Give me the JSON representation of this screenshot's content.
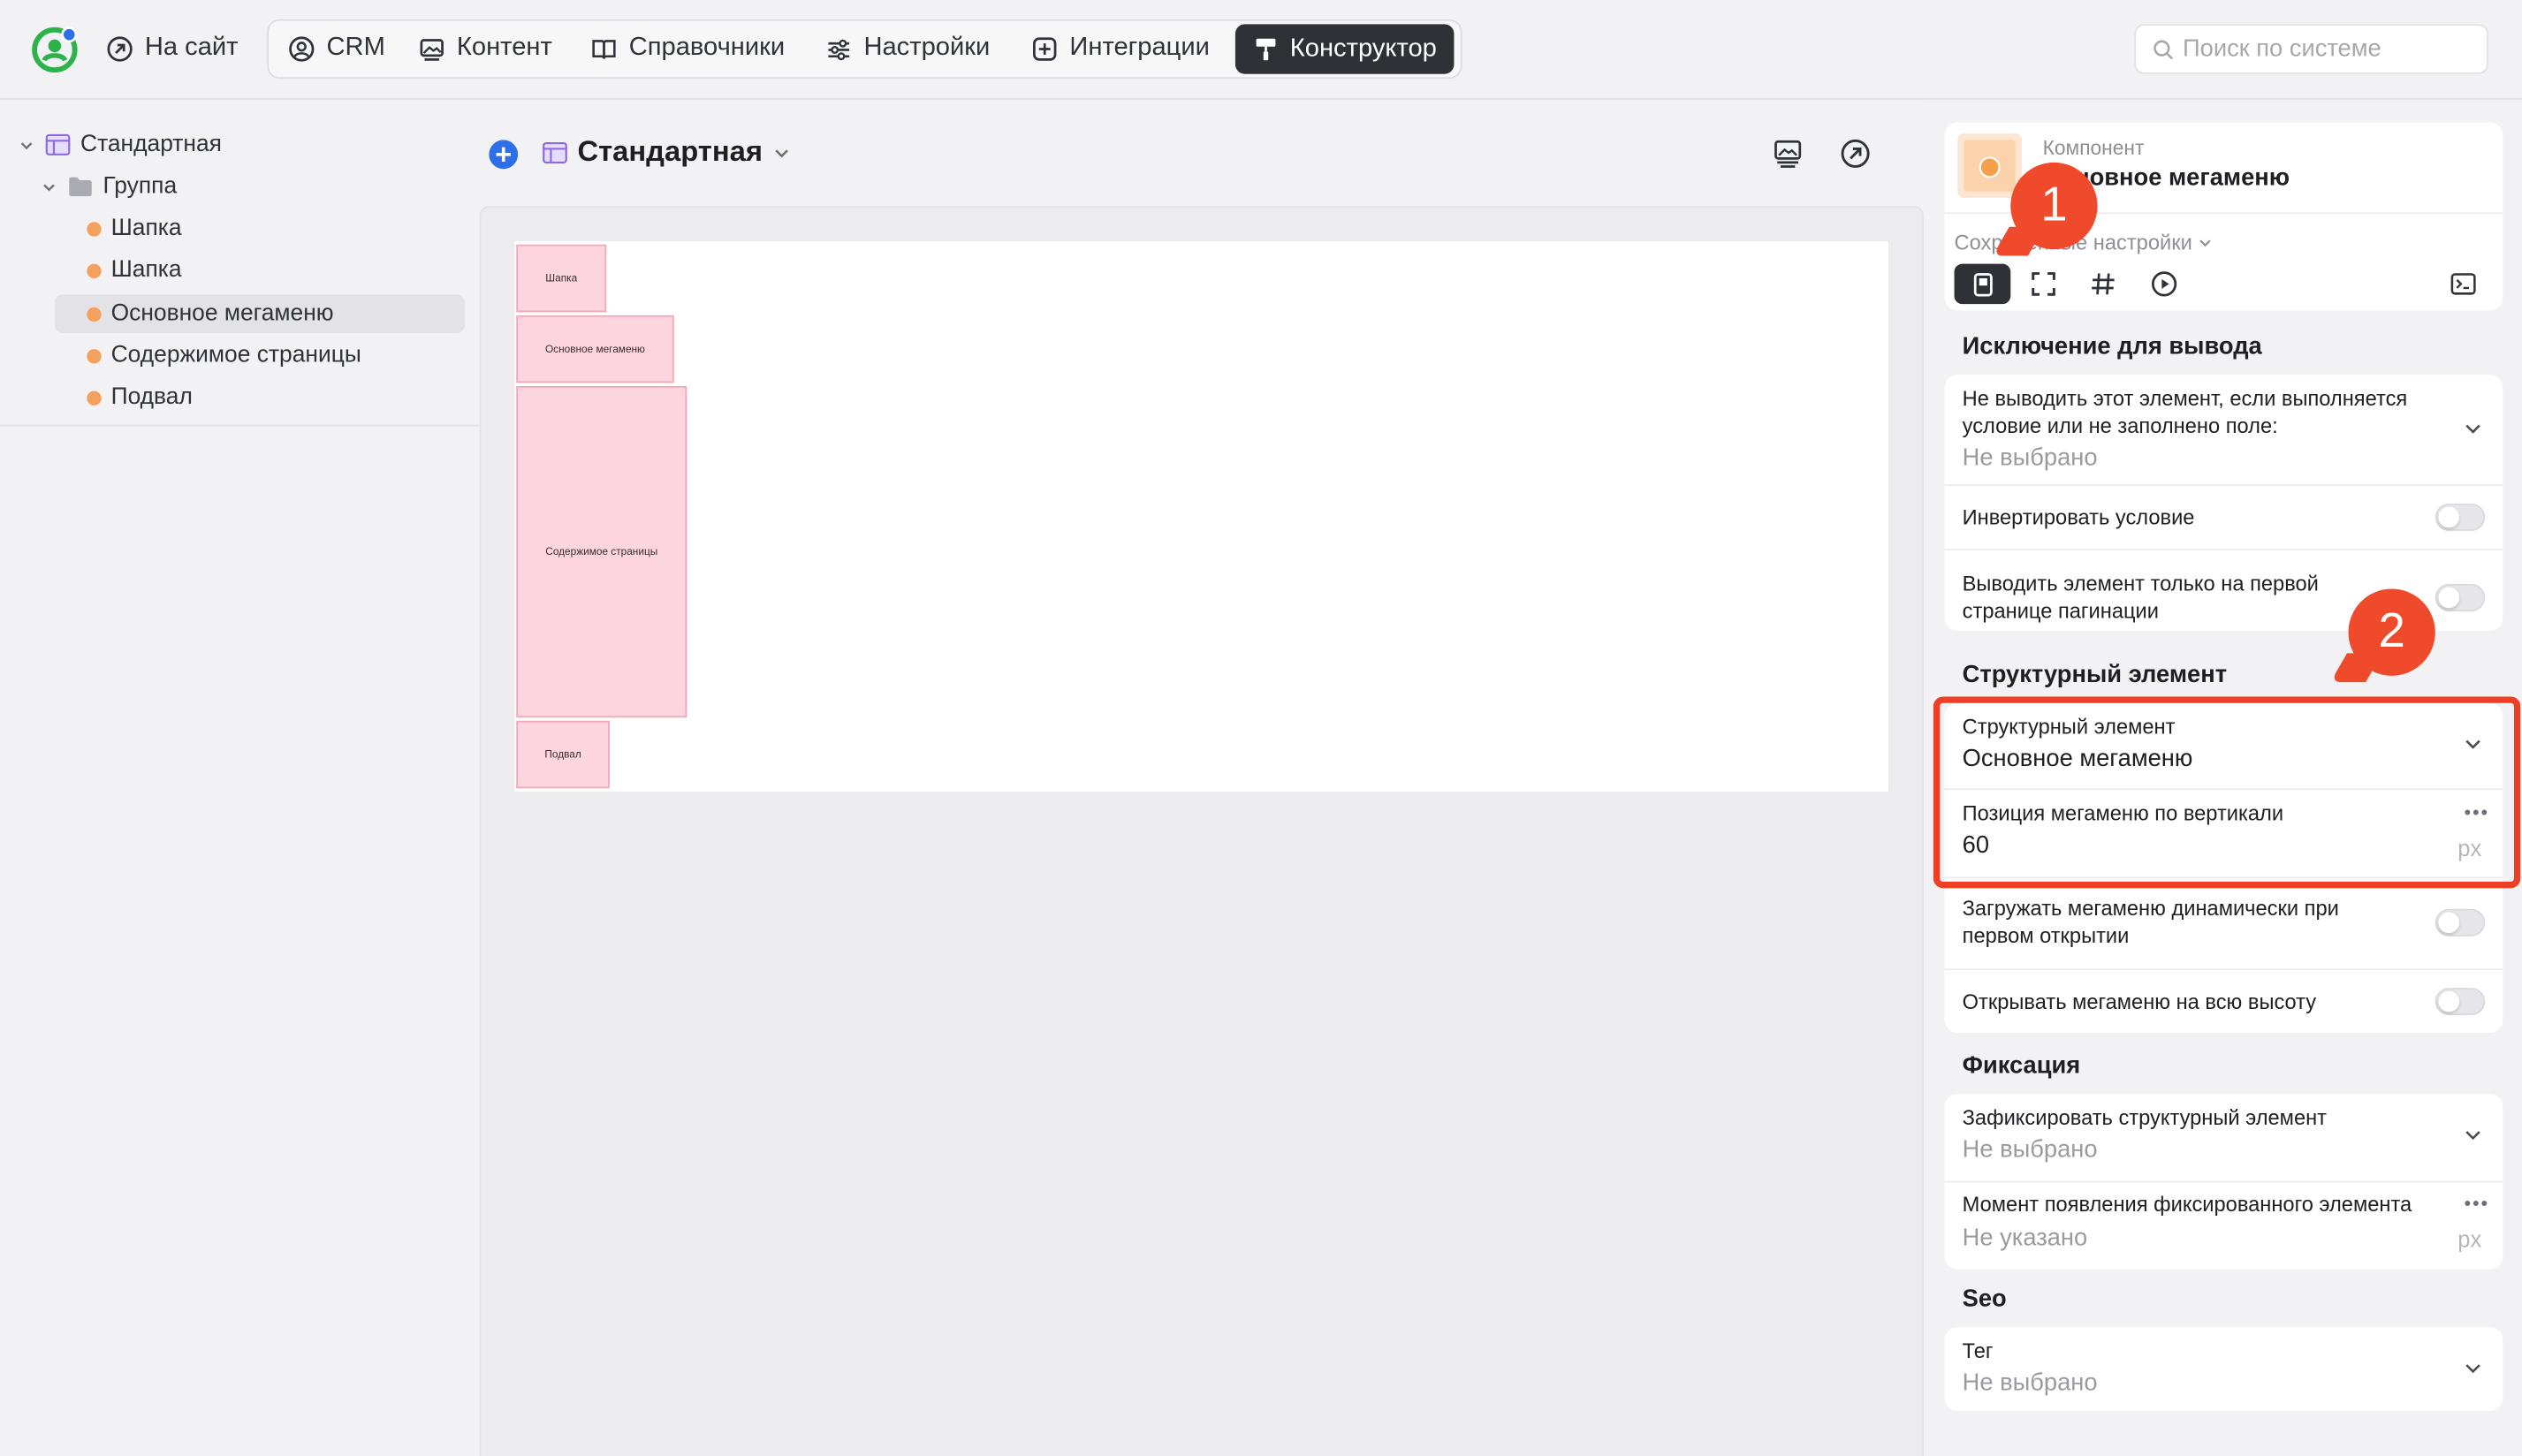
{
  "colors": {
    "accent_dark": "#2f3137",
    "tree_dot": "#f4a15d",
    "block_fill": "#fdd5de",
    "annotation_red": "#ee4a2b",
    "add_button": "#2d6fe8",
    "logo_green": "#2bb34a"
  },
  "topbar": {
    "to_site": "На сайт",
    "nav": [
      {
        "label": "CRM",
        "icon": "crm-icon"
      },
      {
        "label": "Контент",
        "icon": "image-icon"
      },
      {
        "label": "Справочники",
        "icon": "book-icon"
      },
      {
        "label": "Настройки",
        "icon": "sliders-icon"
      },
      {
        "label": "Интеграции",
        "icon": "plus-square-icon"
      },
      {
        "label": "Конструктор",
        "icon": "paint-roller-icon",
        "active": true
      }
    ],
    "search_placeholder": "Поиск по системе"
  },
  "tree": {
    "root": "Стандартная",
    "group": "Группа",
    "items": [
      "Шапка",
      "Шапка",
      "Основное мегаменю",
      "Содержимое страницы",
      "Подвал"
    ],
    "selected_index": 2
  },
  "canvas": {
    "page_name": "Стандартная",
    "blocks": [
      "Шапка",
      "Основное мегаменю",
      "Содержимое страницы",
      "Подвал"
    ]
  },
  "panel": {
    "component_caption": "Компонент",
    "component_name": "Основное мегаменю",
    "saved_settings": "Сохранённые настройки",
    "annotations": [
      "1",
      "2"
    ],
    "sections": {
      "exclusion": {
        "title": "Исключение для вывода",
        "condition_label_1": "Не выводить этот элемент, если выполняется",
        "condition_label_2": "условие или не заполнено поле:",
        "condition_value": "Не выбрано",
        "invert": "Инвертировать условие",
        "first_page_1": "Выводить элемент только на первой",
        "first_page_2": "странице пагинации"
      },
      "structural": {
        "title": "Структурный элемент",
        "element_label": "Структурный элемент",
        "element_value": "Основное мегаменю",
        "position_label": "Позиция мегаменю по вертикали",
        "position_value": "60",
        "position_unit": "px",
        "dynamic_1": "Загружать мегаменю динамически при",
        "dynamic_2": "первом открытии",
        "full_height": "Открывать мегаменю на всю высоту"
      },
      "fixation": {
        "title": "Фиксация",
        "fix_label": "Зафиксировать структурный элемент",
        "fix_value": "Не выбрано",
        "moment_label": "Момент появления фиксированного элемента",
        "moment_value": "Не указано",
        "moment_unit": "px"
      },
      "seo": {
        "title": "Seo",
        "tag_label": "Тег",
        "tag_value": "Не выбрано"
      }
    }
  }
}
